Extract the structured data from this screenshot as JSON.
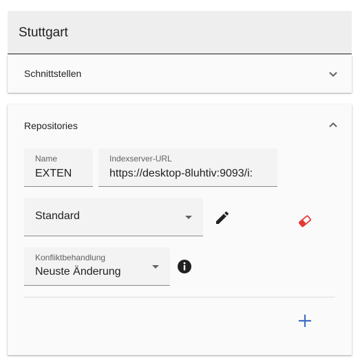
{
  "header": {
    "title": "Stuttgart"
  },
  "panels": [
    {
      "label": "Schnittstellen",
      "expanded": false,
      "icon": "chevron-down-icon"
    },
    {
      "label": "Repositories",
      "expanded": true,
      "icon": "chevron-up-icon",
      "fields": {
        "name": {
          "label": "Name",
          "value": "EXTEN"
        },
        "url": {
          "label": "Indexserver-URL",
          "value": "https://desktop-8luhtiv:9093/i:"
        },
        "standard": {
          "value": "Standard"
        },
        "konflikt": {
          "label": "Konfliktbehandlung",
          "value": "Neuste Änderung"
        }
      },
      "icons": {
        "edit": "pencil-icon",
        "clear": "eraser-icon",
        "info": "info-icon",
        "add": "plus-icon"
      }
    }
  ],
  "colors": {
    "header_bg": "#eeeeee",
    "panel_bg": "#fafafa",
    "field_bg": "#f3f3f3",
    "eraser": "#e53935",
    "add": "#3f6fc4"
  }
}
